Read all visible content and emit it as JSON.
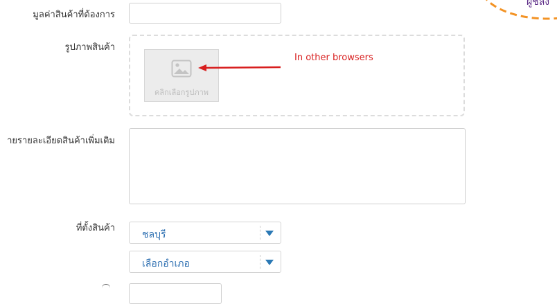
{
  "form": {
    "desired_value_label": "มูลค่าสินค้าที่ต้องการ",
    "desired_value_input": "",
    "image_label": "รูปภาพสินค้า",
    "image_placeholder_text": "คลิกเลือกรูปภาพ",
    "annotation_text": "In other browsers",
    "description_label": "ายรายละเอียดสินค้าเพิ่มเติม",
    "description_value": "",
    "location_label": "ที่ตั้งสินค้า",
    "province_value": "ชลบุรี",
    "district_value": "เลือกอำเภอ"
  },
  "corner": {
    "text": "ผู้ชลง"
  },
  "colors": {
    "accent_blue": "#2a6db0",
    "annotation_red": "#d81f1f",
    "dashed_orange": "#f39325"
  }
}
